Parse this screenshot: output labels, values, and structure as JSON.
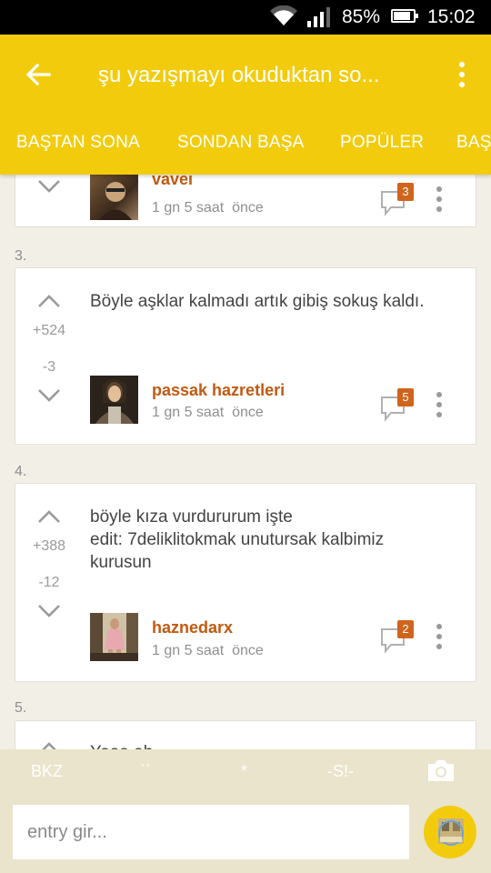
{
  "status_bar": {
    "battery_percent": "85%",
    "battery_level": 0.85,
    "time": "15:02",
    "icons": [
      "wifi-icon",
      "signal-icon",
      "battery-icon"
    ]
  },
  "app_bar": {
    "title": "şu yazışmayı okuduktan so...",
    "back_icon": "arrow-back-icon",
    "menu_icon": "overflow-menu-icon",
    "color": "#f2cc0c"
  },
  "tabs": [
    "BAŞTAN SONA",
    "SONDAN BAŞA",
    "POPÜLER",
    "BAŞ"
  ],
  "entries": [
    {
      "author": "vavei",
      "time": "1 gn 5 saat  önce",
      "comments": "3"
    },
    {
      "number": "3.",
      "text": "Böyle aşklar kalmadı artık gibiş sokuş kaldı.",
      "upvotes": "+524",
      "downvotes": "-3",
      "author": "passak hazretleri",
      "time": "1 gn 5 saat  önce",
      "comments": "5"
    },
    {
      "number": "4.",
      "text": "böyle kıza vurdururum işte\nedit: 7deliklitokmak unutursak kalbimiz kurusun",
      "upvotes": "+388",
      "downvotes": "-12",
      "author": "haznedarx",
      "time": "1 gn 5 saat  önce",
      "comments": "2"
    },
    {
      "number": "5.",
      "text": "Yaaa ah..."
    }
  ],
  "toolbar": {
    "bkz": "BKZ",
    "quote": "``",
    "star": "*",
    "spoiler": "-S!-",
    "camera_icon": "camera-icon"
  },
  "compose": {
    "placeholder": "entry gir..."
  },
  "colors": {
    "accent": "#f2cc0c",
    "author": "#c05a12",
    "badge": "#d0641c",
    "toolbar": "#e9e4cb"
  }
}
